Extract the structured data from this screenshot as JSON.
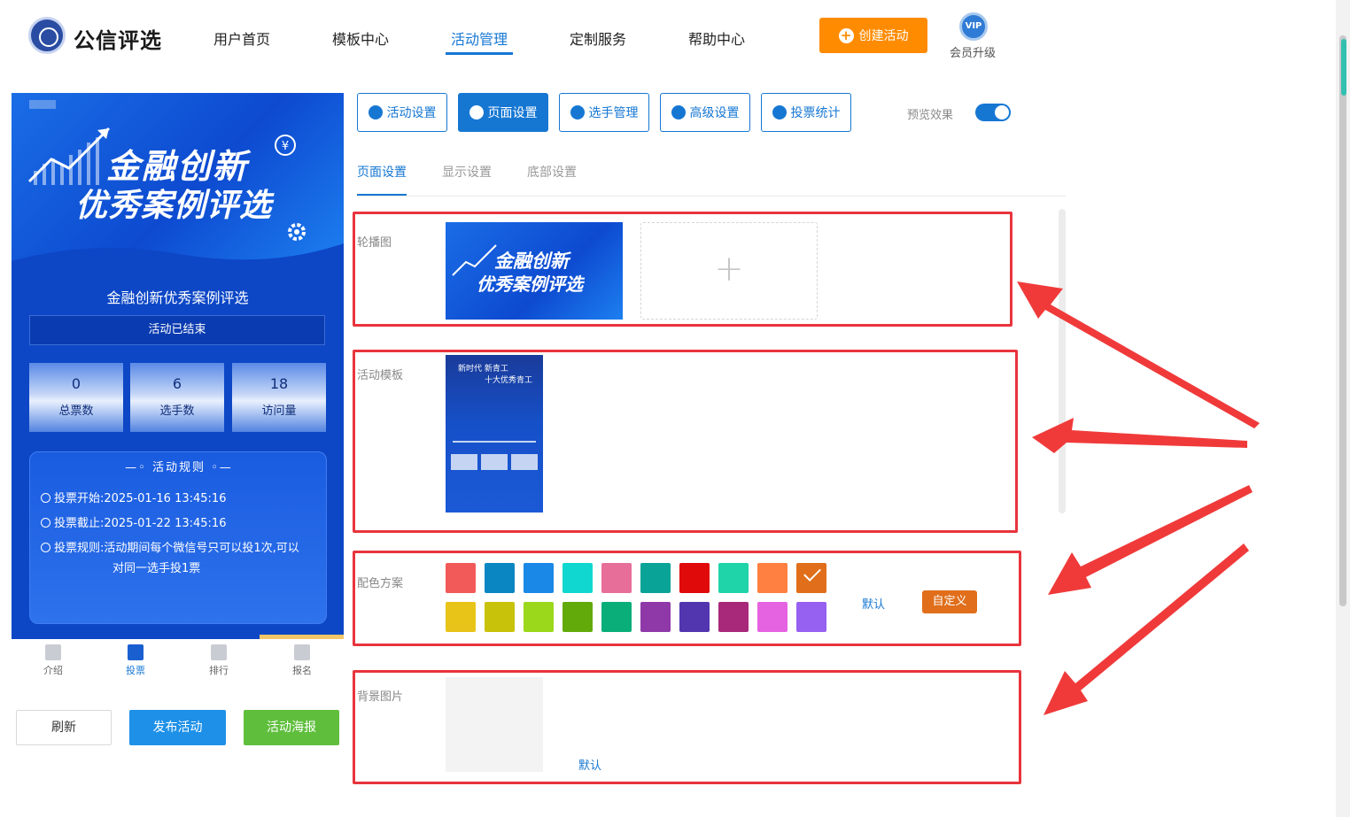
{
  "header": {
    "brand": "公信评选",
    "nav": [
      "用户首页",
      "模板中心",
      "活动管理",
      "定制服务",
      "帮助中心"
    ],
    "active_nav": "活动管理",
    "create_label": "创建活动",
    "vip_badge": "VIP",
    "vip_label": "会员升级",
    "accent": "#1677d3",
    "create_color": "#ff8c00"
  },
  "preview": {
    "banner_line1": "金融创新",
    "banner_line2": "优秀案例评选",
    "title": "金融创新优秀案例评选",
    "status": "活动已结束",
    "stats": [
      {
        "value": "0",
        "label": "总票数"
      },
      {
        "value": "6",
        "label": "选手数"
      },
      {
        "value": "18",
        "label": "访问量"
      }
    ],
    "rules_title": "活动规则",
    "rules": [
      {
        "label": "投票开始:",
        "value": "2025-01-16 13:45:16"
      },
      {
        "label": "投票截止:",
        "value": "2025-01-22 13:45:16"
      },
      {
        "label": "投票规则:",
        "value": "活动期间每个微信号只可以投1次,可以",
        "value2": "对同一选手投1票"
      }
    ],
    "tabs": [
      "介绍",
      "投票",
      "排行",
      "报名"
    ],
    "active_tab": "投票",
    "buttons": {
      "refresh": "刷新",
      "publish": "发布活动",
      "poster": "活动海报"
    }
  },
  "settings": {
    "buttons": [
      {
        "label": "活动设置",
        "icon": "star-icon"
      },
      {
        "label": "页面设置",
        "icon": "gear-icon"
      },
      {
        "label": "选手管理",
        "icon": "users-icon"
      },
      {
        "label": "高级设置",
        "icon": "sliders-icon"
      },
      {
        "label": "投票统计",
        "icon": "bar-chart-icon"
      }
    ],
    "active_button": "页面设置",
    "preview_label": "预览效果",
    "preview_on": true,
    "subtabs": [
      "页面设置",
      "显示设置",
      "底部设置"
    ],
    "active_subtab": "页面设置",
    "carousel_label": "轮播图",
    "carousel_line1": "金融创新",
    "carousel_line2": "优秀案例评选",
    "template_label": "活动模板",
    "template_line1": "新时代 新青工",
    "template_line2": "十大优秀青工",
    "color_label": "配色方案",
    "colors_row1": [
      "#f25a5a",
      "#0a86c2",
      "#1a88e6",
      "#10d8d0",
      "#e86e9a",
      "#09a397",
      "#e00a0a",
      "#1fd4a8",
      "#ff8040",
      "#e06e1a"
    ],
    "colors_row2": [
      "#e8c419",
      "#c8c20a",
      "#9bd71a",
      "#62aa0a",
      "#0aae78",
      "#8f39a9",
      "#5136b0",
      "#a8287a",
      "#e562e0",
      "#9660f0"
    ],
    "selected_color": "#e06e1a",
    "default_label": "默认",
    "custom_label": "自定义",
    "bg_label": "背景图片",
    "bg_default_label": "默认"
  }
}
